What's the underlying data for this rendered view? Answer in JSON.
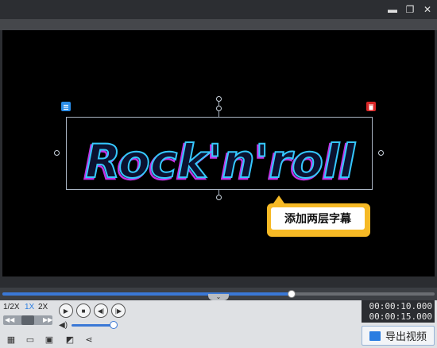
{
  "window": {
    "min_symbol": "▬",
    "restore_symbol": "❐",
    "close_symbol": "✕"
  },
  "canvas": {
    "title_text": "Rock'n'roll",
    "tooltip_text": "添加两层字幕",
    "colors": {
      "text_fill": "#0b1230",
      "outline_cyan": "#35c8ff",
      "outline_magenta": "#c235e6",
      "edit_icon": "#2a8de8",
      "delete_icon": "#d92626",
      "tooltip": "#f6b925"
    }
  },
  "playback": {
    "progress_fraction": 0.67,
    "speeds": [
      "1/2X",
      "1X",
      "2X"
    ],
    "active_speed": "1X",
    "volume_fraction": 0.95,
    "current_time": "00:00:10.000",
    "total_time": "00:00:15.000"
  },
  "toolbar": {
    "export_label": "导出视频",
    "icons": [
      "clip-icon",
      "folder-icon",
      "save-icon",
      "save-as-icon",
      "share-icon"
    ]
  }
}
